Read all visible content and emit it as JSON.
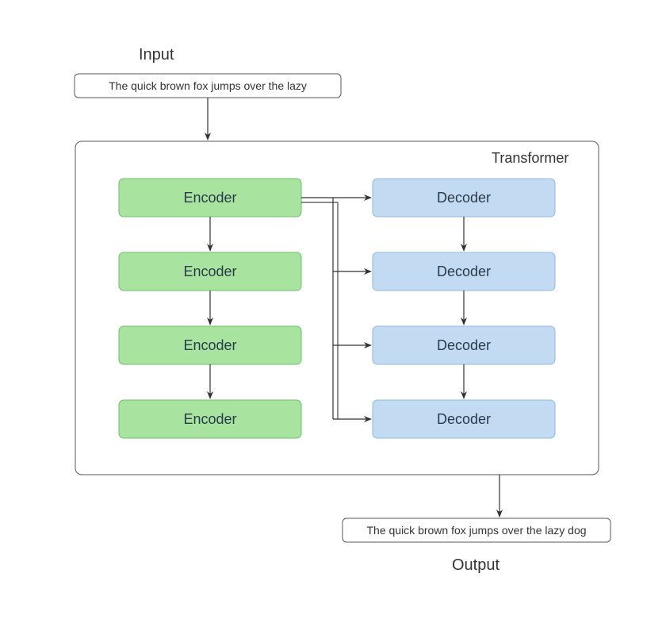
{
  "labels": {
    "input": "Input",
    "output": "Output",
    "transformer": "Transformer"
  },
  "input_text": "The quick brown fox jumps over the lazy",
  "output_text": "The quick brown fox jumps over the lazy dog",
  "encoders": [
    "Encoder",
    "Encoder",
    "Encoder",
    "Encoder"
  ],
  "decoders": [
    "Decoder",
    "Decoder",
    "Decoder",
    "Decoder"
  ],
  "colors": {
    "encoder_fill": "#a8e4a0",
    "encoder_stroke": "#6fbf6a",
    "decoder_fill": "#c3dbf2",
    "decoder_stroke": "#8fb8dd",
    "line": "#333333"
  }
}
